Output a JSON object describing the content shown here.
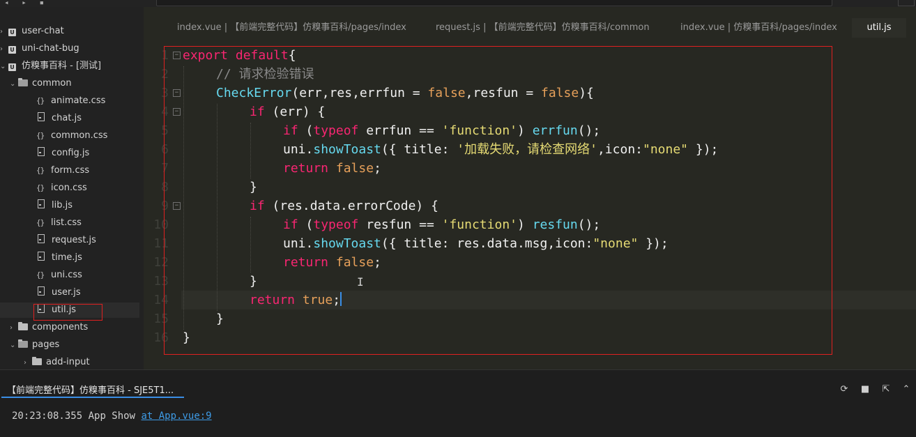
{
  "sidebar": {
    "projects": [
      "user-chat",
      "uni-chat-bug",
      "仿糗事百科 - [测试]"
    ],
    "folders": {
      "common": "common",
      "components": "components",
      "pages": "pages",
      "add_input": "add-input"
    },
    "files": [
      "animate.css",
      "chat.js",
      "common.css",
      "config.js",
      "form.css",
      "icon.css",
      "lib.js",
      "list.css",
      "request.js",
      "time.js",
      "uni.css",
      "user.js",
      "util.js"
    ]
  },
  "tabs": [
    {
      "label": "index.vue | 【前端完整代码】仿糗事百科/pages/index"
    },
    {
      "label": "request.js | 【前端完整代码】仿糗事百科/common"
    },
    {
      "label": "index.vue | 仿糗事百科/pages/index"
    },
    {
      "label": "util.js"
    }
  ],
  "editor": {
    "line_numbers": [
      "1",
      "2",
      "3",
      "4",
      "5",
      "6",
      "7",
      "8",
      "9",
      "10",
      "11",
      "12",
      "13",
      "14",
      "15",
      "16"
    ],
    "code": {
      "l1_kw": "export default",
      "l1_rest": "{",
      "l2": "// 请求检验错误",
      "l3_fn": "CheckError",
      "l3_a": "(err,res,errfun = ",
      "l3_b": "false",
      "l3_c": ",resfun = ",
      "l3_d": "false",
      "l3_e": "){",
      "l4_kw": "if",
      "l4_rest": " (err) {",
      "l5_kw": "if",
      "l5_a": " (",
      "l5_kw2": "typeof",
      "l5_b": " errfun == ",
      "l5_str": "'function'",
      "l5_c": ") ",
      "l5_fn": "errfun",
      "l5_d": "();",
      "l6_a": "uni.",
      "l6_fn": "showToast",
      "l6_b": "({ title: ",
      "l6_str": "'加载失败，请检查网络'",
      "l6_c": ",icon:",
      "l6_str2": "\"none\"",
      "l6_d": " });",
      "l7_kw": "return",
      "l7_b": "false",
      "l7_c": ";",
      "l8": "}",
      "l9_kw": "if",
      "l9_rest": " (res.data.errorCode) {",
      "l10_kw": "if",
      "l10_a": " (",
      "l10_kw2": "typeof",
      "l10_b": " resfun == ",
      "l10_str": "'function'",
      "l10_c": ") ",
      "l10_fn": "resfun",
      "l10_d": "();",
      "l11_a": "uni.",
      "l11_fn": "showToast",
      "l11_b": "({ title: res.data.msg,icon:",
      "l11_str": "\"none\"",
      "l11_c": " });",
      "l12_kw": "return",
      "l12_b": "false",
      "l12_c": ";",
      "l13": "}",
      "l14_kw": "return",
      "l14_b": "true",
      "l14_c": ";",
      "l15": "}",
      "l16": "}"
    }
  },
  "panel": {
    "tab_label": "【前端完整代码】仿糗事百科 - SJE5T1...",
    "console_time": "20:23:08.355",
    "console_msg": "App Show",
    "console_link": "at App.vue:9"
  }
}
